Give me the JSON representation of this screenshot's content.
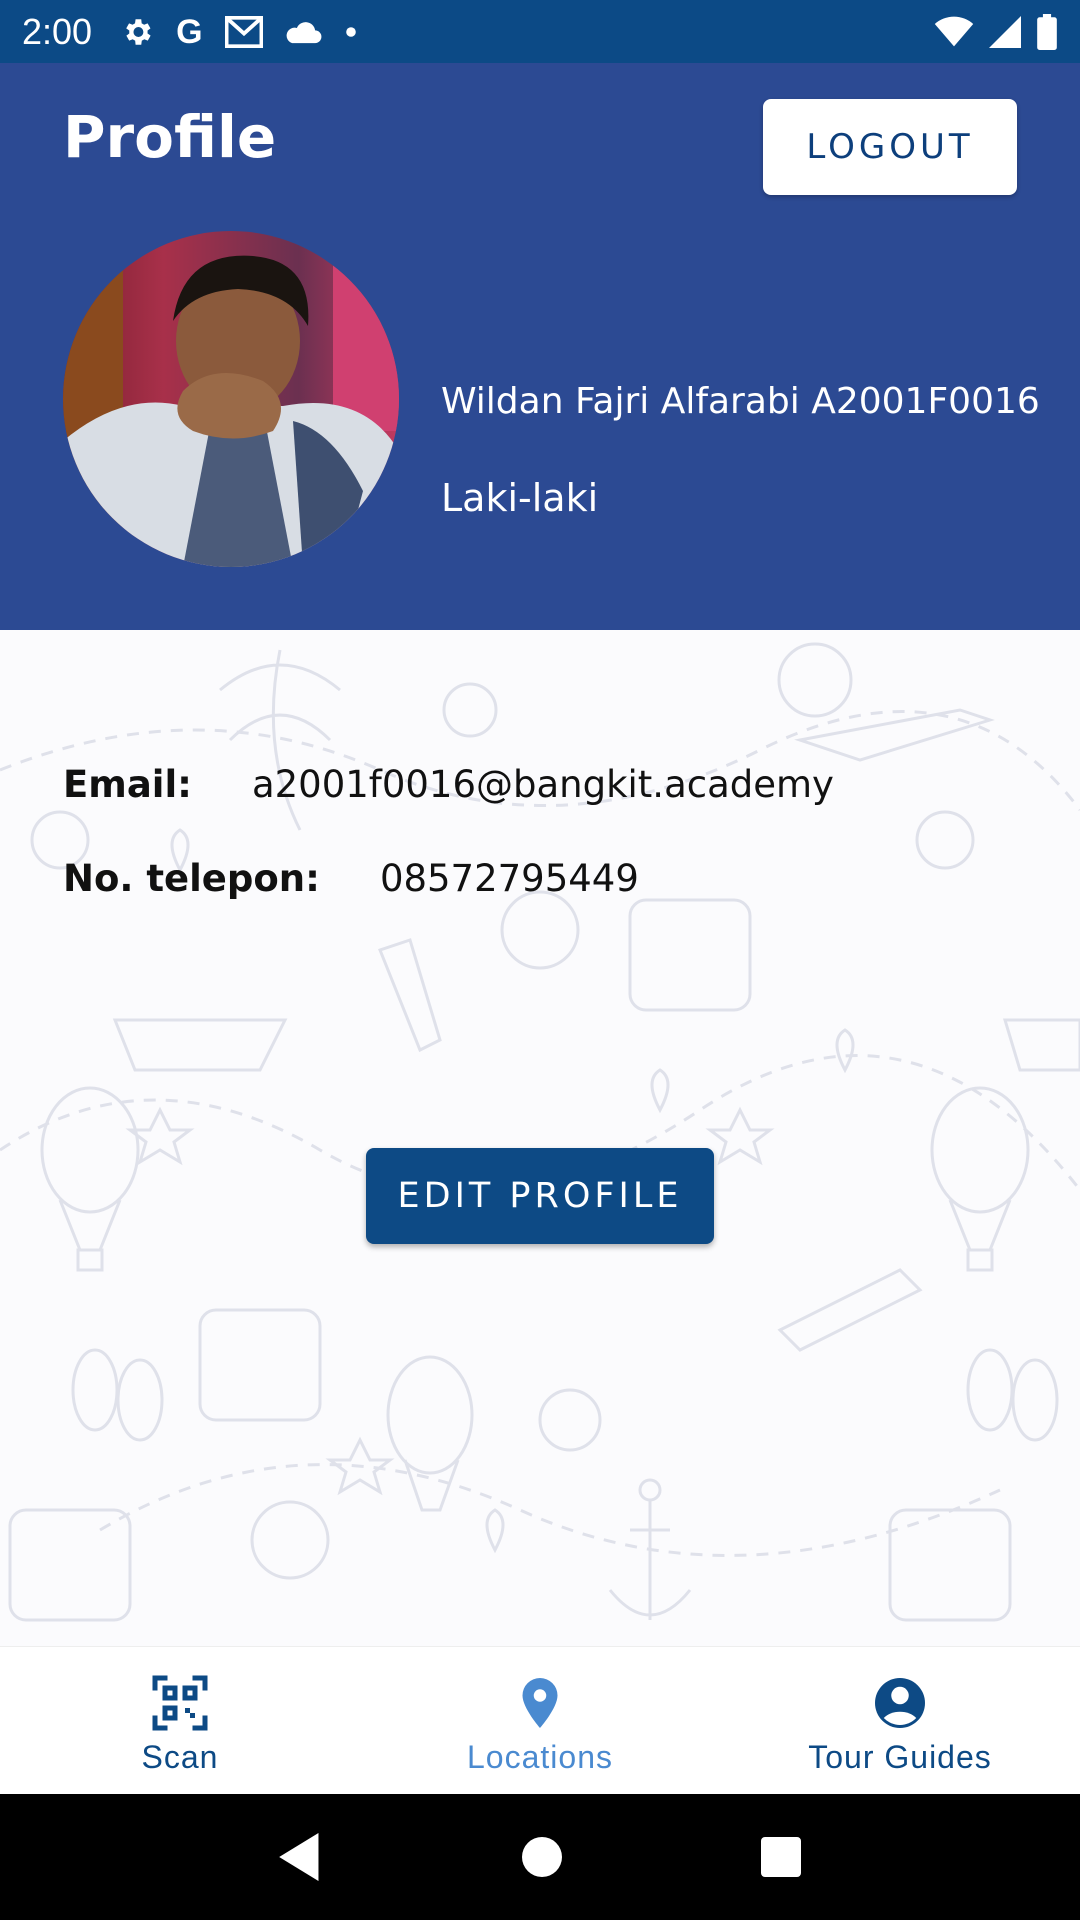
{
  "status_bar": {
    "time": "2:00",
    "left_icons": [
      "settings-icon",
      "google-icon",
      "gmail-icon",
      "cloud-icon",
      "dot-icon"
    ],
    "right_icons": [
      "wifi-icon",
      "signal-icon",
      "battery-icon"
    ]
  },
  "header": {
    "title": "Profile",
    "logout_label": "LOGOUT",
    "background_color": "#2c4a93"
  },
  "profile": {
    "name": "Wildan Fajri Alfarabi A2001F0016",
    "gender": "Laki-laki"
  },
  "info": {
    "email_label": "Email:",
    "email_value": "a2001f0016@bangkit.academy",
    "phone_label": "No. telepon:",
    "phone_value": "08572795449"
  },
  "actions": {
    "edit_label": "EDIT PROFILE",
    "edit_color": "#0d4a85"
  },
  "bottom_nav": {
    "items": [
      {
        "label": "Scan",
        "icon": "qr-scan-icon",
        "color": "#0d4a85"
      },
      {
        "label": "Locations",
        "icon": "location-pin-icon",
        "color": "#4a8ad0"
      },
      {
        "label": "Tour Guides",
        "icon": "account-circle-icon",
        "color": "#0d4a85"
      }
    ]
  },
  "system_nav": [
    "back-icon",
    "home-icon",
    "recents-icon"
  ]
}
